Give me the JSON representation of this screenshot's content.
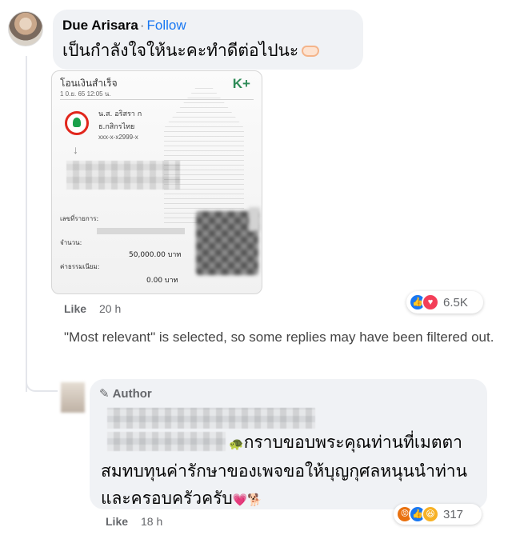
{
  "comment": {
    "author": "Due Arisara",
    "separator": "·",
    "follow_label": "Follow",
    "text": "เป็นกำลังใจให้นะคะทำดีต่อไปนะ",
    "like_label": "Like",
    "time": "20 h",
    "reaction_count": "6.5K",
    "reaction_icons": [
      "like-reaction-icon",
      "love-reaction-icon"
    ]
  },
  "receipt": {
    "title": "โอนเงินสำเร็จ",
    "date": "1 0.ย. 65  12:05 น.",
    "logo": "K+",
    "sender_name": "น.ส. อริสรา ก",
    "sender_bank": "ธ.กสิกรไทย",
    "sender_account": "xxx-x-x2999-x",
    "ref_label": "เลขที่รายการ:",
    "amount_label": "จำนวน:",
    "amount_value": "50,000.00 บาท",
    "fee_label": "ค่าธรรมเนียม:",
    "fee_value": "0.00 บาท"
  },
  "filter_note": "\"Most relevant\" is selected, so some replies may have been filtered out.",
  "reply": {
    "badge": "Author",
    "text": "กราบขอบพระคุณท่านที่เมตตาสมทบทุนค่ารักษาของเพจขอให้บุญกุศลหนุนนำท่านและครอบครัวครับ",
    "like_label": "Like",
    "time": "18 h",
    "reaction_count": "317",
    "reaction_icons": [
      "angry-reaction-icon",
      "like-reaction-icon",
      "haha-reaction-icon"
    ]
  }
}
